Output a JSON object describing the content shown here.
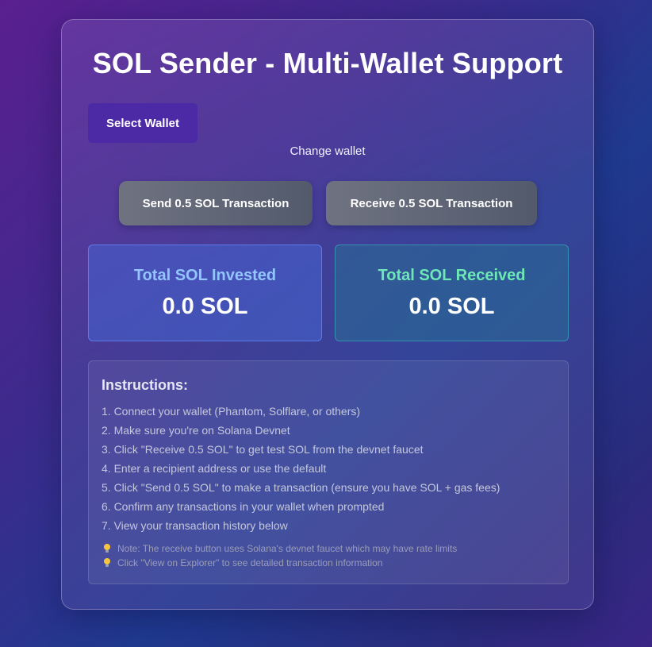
{
  "app": {
    "title": "SOL Sender - Multi-Wallet Support"
  },
  "wallet": {
    "select_label": "Select Wallet",
    "change_label": "Change wallet"
  },
  "actions": {
    "send_label": "Send 0.5 SOL Transaction",
    "receive_label": "Receive 0.5 SOL Transaction"
  },
  "stats": {
    "invested": {
      "label": "Total SOL Invested",
      "value": "0.0 SOL",
      "color": "#93c5fd"
    },
    "received": {
      "label": "Total SOL Received",
      "value": "0.0 SOL",
      "color": "#6ee7b7"
    }
  },
  "instructions": {
    "title": "Instructions:",
    "steps": [
      "1. Connect your wallet (Phantom, Solflare, or others)",
      "2. Make sure you're on Solana Devnet",
      "3. Click \"Receive 0.5 SOL\" to get test SOL from the devnet faucet",
      "4. Enter a recipient address or use the default",
      "5. Click \"Send 0.5 SOL\" to make a transaction (ensure you have SOL + gas fees)",
      "6. Confirm any transactions in your wallet when prompted",
      "7. View your transaction history below"
    ],
    "notes": [
      {
        "icon": "lightbulb-icon",
        "text": "Note: The receive button uses Solana's devnet faucet which may have rate limits"
      },
      {
        "icon": "lightbulb-icon",
        "text": "Click \"View on Explorer\" to see detailed transaction information"
      }
    ]
  },
  "colors": {
    "select_wallet_button": "#4c2aa6",
    "tx_button": "#5f6576"
  }
}
